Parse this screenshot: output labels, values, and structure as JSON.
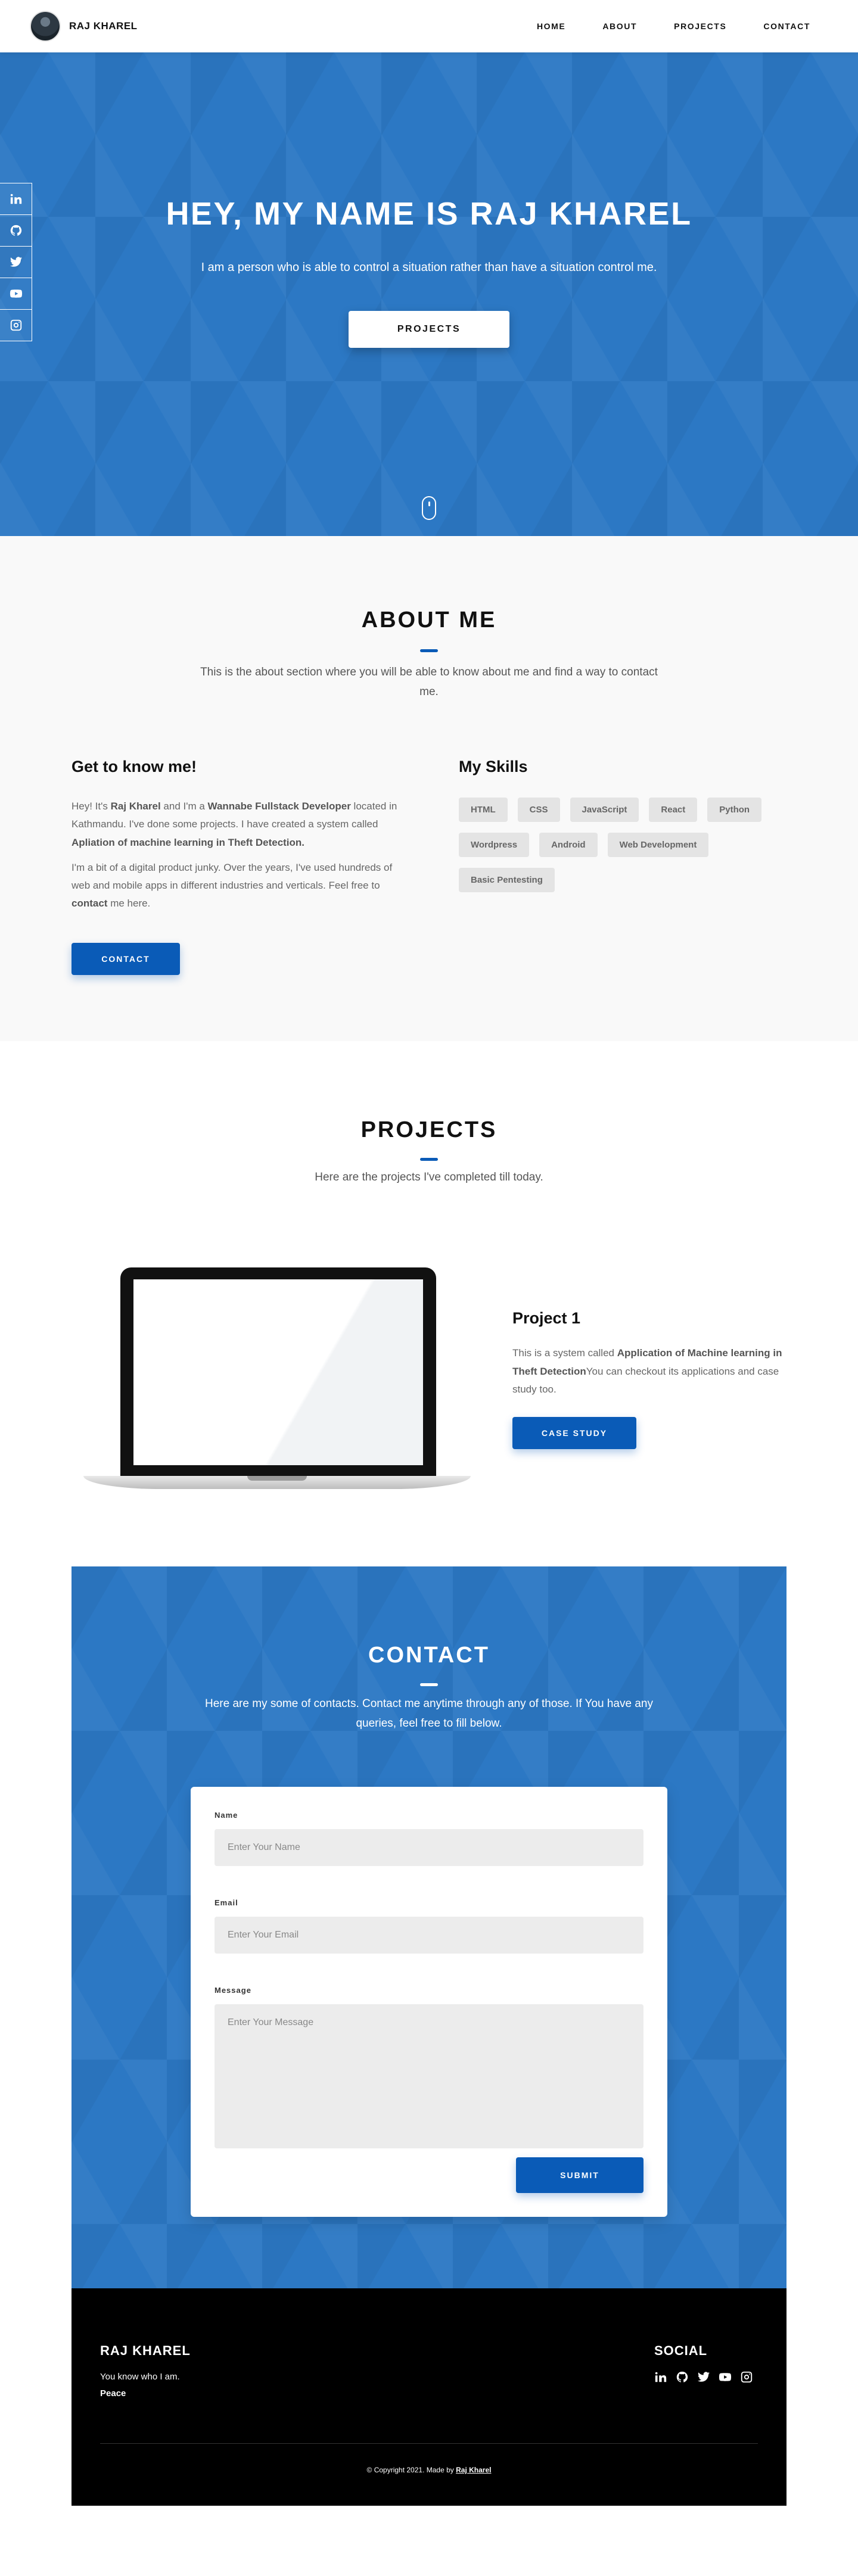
{
  "header": {
    "brand": "RAJ KHAREL",
    "nav": [
      "HOME",
      "ABOUT",
      "PROJECTS",
      "CONTACT"
    ]
  },
  "hero": {
    "title": "HEY, MY NAME IS RAJ KHAREL",
    "subtitle": "I am a person who is able to control a situation rather than have a situation control me.",
    "button": "PROJECTS"
  },
  "social": [
    "linkedin-icon",
    "github-icon",
    "twitter-icon",
    "youtube-icon",
    "instagram-icon"
  ],
  "about": {
    "title": "ABOUT ME",
    "description": "This is the about section where you will be able to know about me and find a way to contact me.",
    "left_heading": "Get to know me!",
    "p1_a": "Hey! It's ",
    "p1_b": "Raj Kharel",
    "p1_c": " and I'm a ",
    "p1_d": "Wannabe Fullstack Developer",
    "p1_e": " located in Kathmandu. I've done some projects. I have created a system called ",
    "p1_f": "Apliation of machine learning in Theft Detection.",
    "p2_a": "I'm a bit of a digital product junky. Over the years, I've used hundreds of web and mobile apps in different industries and verticals. Feel free to ",
    "p2_b": "contact",
    "p2_c": " me here.",
    "button": "CONTACT",
    "right_heading": "My Skills",
    "skills": [
      "HTML",
      "CSS",
      "JavaScript",
      "React",
      "Python",
      "Wordpress",
      "Android",
      "Web Development",
      "Basic Pentesting"
    ]
  },
  "projects": {
    "title": "PROJECTS",
    "description": "Here are the projects I've completed till today.",
    "items": [
      {
        "title": "Project 1",
        "desc_a": "This is a system called ",
        "desc_b": "Application of Machine learning in Theft Detection",
        "desc_c": "You can checkout its applications and case study too.",
        "button": "CASE STUDY"
      }
    ]
  },
  "contact": {
    "title": "CONTACT",
    "description": "Here are my some of contacts. Contact me anytime through any of those. If You have any queries, feel free to fill below.",
    "name_label": "Name",
    "name_placeholder": "Enter Your Name",
    "email_label": "Email",
    "email_placeholder": "Enter Your Email",
    "message_label": "Message",
    "message_placeholder": "Enter Your Message",
    "submit": "SUBMIT"
  },
  "footer": {
    "brand": "RAJ KHAREL",
    "tagline": "You know who I am.",
    "peace": "Peace",
    "social_title": "SOCIAL",
    "copy_a": "© Copyright 2021. Made by ",
    "copy_b": "Raj Kharel"
  },
  "colors": {
    "primary": "#0a5bb7",
    "hero_bg": "#2c78c4",
    "footer_bg": "#000000"
  }
}
